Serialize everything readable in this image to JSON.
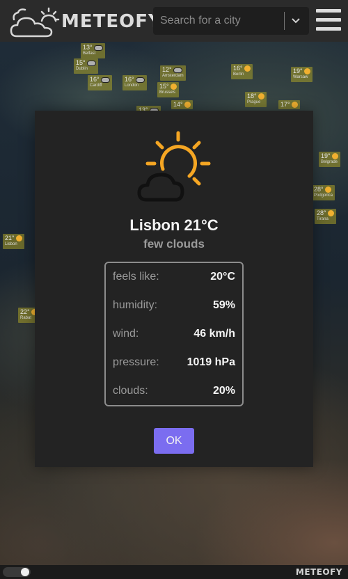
{
  "header": {
    "brand": "METEOFY",
    "search_placeholder": "Search for a city"
  },
  "modal": {
    "city_title": "Lisbon 21°C",
    "description": "few clouds",
    "icon": "sun-behind-cloud-icon",
    "details": [
      {
        "key": "feels like:",
        "value": "20°C"
      },
      {
        "key": "humidity:",
        "value": "59%"
      },
      {
        "key": "wind:",
        "value": "46 km/h"
      },
      {
        "key": "pressure:",
        "value": "1019 hPa"
      },
      {
        "key": "clouds:",
        "value": "20%"
      }
    ],
    "ok_label": "OK"
  },
  "map_labels": [
    {
      "temp": "13°",
      "name": "Belfast",
      "icon": "cloud-icon"
    },
    {
      "temp": "15°",
      "name": "Dublin",
      "icon": "cloud-icon"
    },
    {
      "temp": "16°",
      "name": "Cardiff",
      "icon": "cloud-icon"
    },
    {
      "temp": "16°",
      "name": "London",
      "icon": "cloud-icon"
    },
    {
      "temp": "12°",
      "name": "Amsterdam",
      "icon": "cloud-icon"
    },
    {
      "temp": "15°",
      "name": "Brussels",
      "icon": "sun-icon"
    },
    {
      "temp": "16°",
      "name": "Berlin",
      "icon": "sun-icon"
    },
    {
      "temp": "19°",
      "name": "Warsaw",
      "icon": "sun-icon"
    },
    {
      "temp": "18°",
      "name": "Prague",
      "icon": "sun-icon"
    },
    {
      "temp": "17°",
      "name": "",
      "icon": "sun-icon"
    },
    {
      "temp": "14°",
      "name": "",
      "icon": "sun-icon"
    },
    {
      "temp": "13°",
      "name": "",
      "icon": "cloud-icon"
    },
    {
      "temp": "19°",
      "name": "Belgrade",
      "icon": "sun-icon"
    },
    {
      "temp": "28°",
      "name": "Podgorica",
      "icon": "sun-icon"
    },
    {
      "temp": "28°",
      "name": "Tirana",
      "icon": "sun-icon"
    },
    {
      "temp": "21°",
      "name": "Lisbon",
      "icon": "sun-icon"
    },
    {
      "temp": "22°",
      "name": "Rabat",
      "icon": "sun-icon"
    }
  ],
  "footer": {
    "brand": "METEOFY",
    "theme_toggle_on": true
  },
  "colors": {
    "accent": "#7b6df0",
    "sun": "#f5a623",
    "header_bg": "#2b2b2b",
    "modal_bg": "#232323"
  }
}
